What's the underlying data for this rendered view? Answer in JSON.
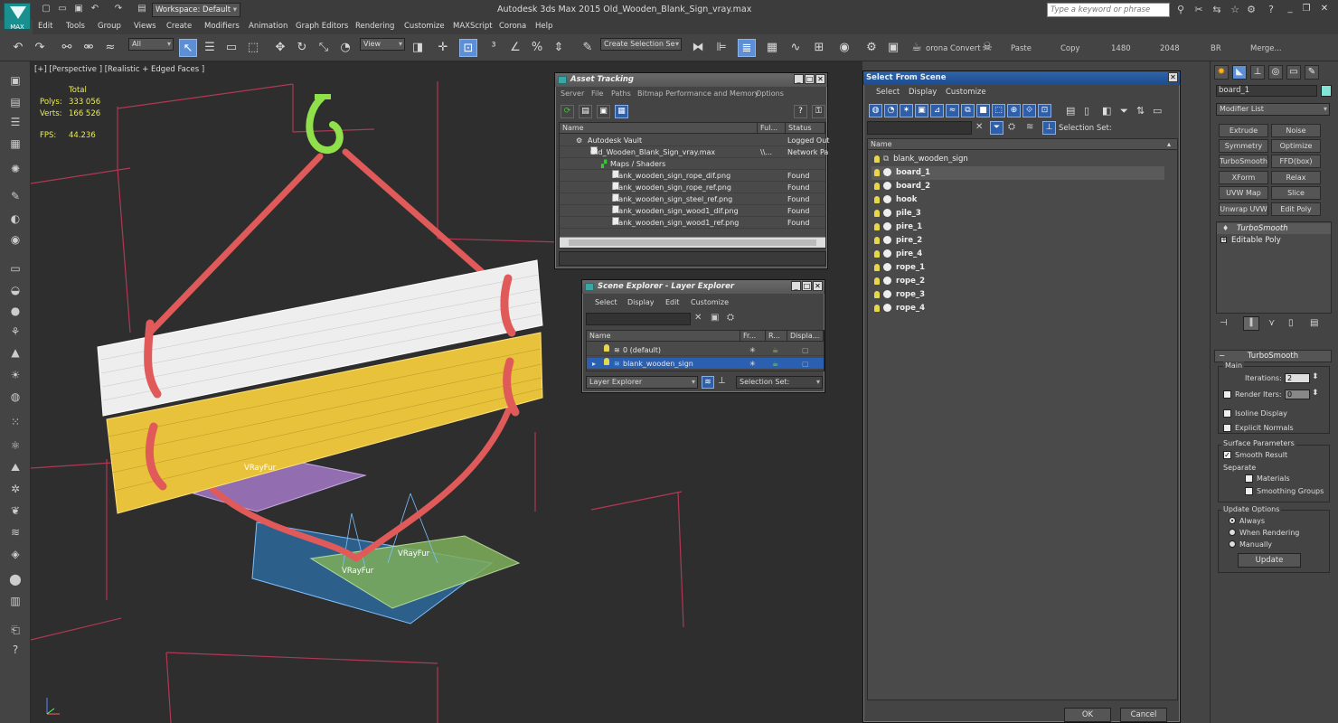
{
  "app": {
    "title": "Autodesk 3ds Max  2015     Old_Wooden_Blank_Sign_vray.max",
    "logo_label": "MAX",
    "workspace": "Workspace: Default",
    "search_placeholder": "Type a keyword or phrase"
  },
  "menu": [
    "Edit",
    "Tools",
    "Group",
    "Views",
    "Create",
    "Modifiers",
    "Animation",
    "Graph Editors",
    "Rendering",
    "Customize",
    "MAXScript",
    "Corona",
    "Help"
  ],
  "toolbar": {
    "filter": "All",
    "view": "View",
    "selection_set": "Create Selection Se",
    "corona_convert": "orona Convert",
    "paste": "Paste",
    "copy": "Copy",
    "res1": "1480",
    "res2": "2048",
    "br": "BR",
    "merge": "Merge..."
  },
  "viewport": {
    "label": "[+] [Perspective ] [Realistic + Edged Faces ]",
    "stats_total": "Total",
    "polys_label": "Polys:",
    "polys_value": "333 056",
    "verts_label": "Verts:",
    "verts_value": "166 526",
    "fps_label": "FPS:",
    "fps_value": "44.236",
    "fur_labels": [
      "VRayFur",
      "VRayFur",
      "VRayFur"
    ]
  },
  "asset_tracking": {
    "title": "Asset Tracking",
    "menus": [
      "Server",
      "File",
      "Paths",
      "Bitmap Performance and Memory",
      "Options"
    ],
    "columns": [
      "Name",
      "Ful...",
      "Status"
    ],
    "rows": [
      {
        "name": "Autodesk Vault",
        "full": "",
        "status": "Logged Out"
      },
      {
        "name": "Old_Wooden_Blank_Sign_vray.max",
        "full": "\\\\...",
        "status": "Network Pa"
      },
      {
        "name": "Maps / Shaders",
        "full": "",
        "status": ""
      },
      {
        "name": "blank_wooden_sign_rope_dif.png",
        "full": "",
        "status": "Found"
      },
      {
        "name": "blank_wooden_sign_rope_ref.png",
        "full": "",
        "status": "Found"
      },
      {
        "name": "blank_wooden_sign_steel_ref.png",
        "full": "",
        "status": "Found"
      },
      {
        "name": "blank_wooden_sign_wood1_dif.png",
        "full": "",
        "status": "Found"
      },
      {
        "name": "blank_wooden_sign_wood1_ref.png",
        "full": "",
        "status": "Found"
      }
    ]
  },
  "scene_explorer": {
    "title": "Scene Explorer - Layer Explorer",
    "menus": [
      "Select",
      "Display",
      "Edit",
      "Customize"
    ],
    "columns": [
      "Name",
      "Fr...",
      "R...",
      "Displa..."
    ],
    "rows": [
      {
        "name": "0 (default)"
      },
      {
        "name": "blank_wooden_sign"
      }
    ],
    "explorer_type": "Layer Explorer",
    "selection_set_label": "Selection Set:"
  },
  "select_from_scene": {
    "title": "Select From Scene",
    "menus": [
      "Select",
      "Display",
      "Customize"
    ],
    "selection_set_label": "Selection Set:",
    "column": "Name",
    "group": "blank_wooden_sign",
    "items": [
      "board_1",
      "board_2",
      "hook",
      "pile_3",
      "pire_1",
      "pire_2",
      "pire_4",
      "rope_1",
      "rope_2",
      "rope_3",
      "rope_4"
    ],
    "ok": "OK",
    "cancel": "Cancel"
  },
  "command_panel": {
    "object_name": "board_1",
    "modifier_list": "Modifier List",
    "buttons": [
      "Extrude",
      "Noise",
      "Symmetry",
      "Optimize",
      "TurboSmooth",
      "FFD(box)",
      "XForm",
      "Relax",
      "UVW Map",
      "Slice",
      "Unwrap UVW",
      "Edit Poly"
    ],
    "stack": [
      "TurboSmooth",
      "Editable Poly"
    ],
    "rollout_title": "TurboSmooth",
    "main": "Main",
    "iterations_label": "Iterations:",
    "iterations_value": "2",
    "render_iters_label": "Render Iters:",
    "render_iters_value": "0",
    "isoline": "Isoline Display",
    "explicit_normals": "Explicit Normals",
    "surface_params": "Surface Parameters",
    "smooth_result": "Smooth Result",
    "separate": "Separate",
    "materials": "Materials",
    "smoothing_groups": "Smoothing Groups",
    "update_options": "Update Options",
    "always": "Always",
    "when_rendering": "When Rendering",
    "manually": "Manually",
    "update": "Update"
  },
  "colors": {
    "accent": "#5c8fd6",
    "rope": "#e05a5a",
    "hook": "#8fe04a",
    "board_white": "#f0f0f0",
    "board_yellow": "#e8c23a"
  }
}
